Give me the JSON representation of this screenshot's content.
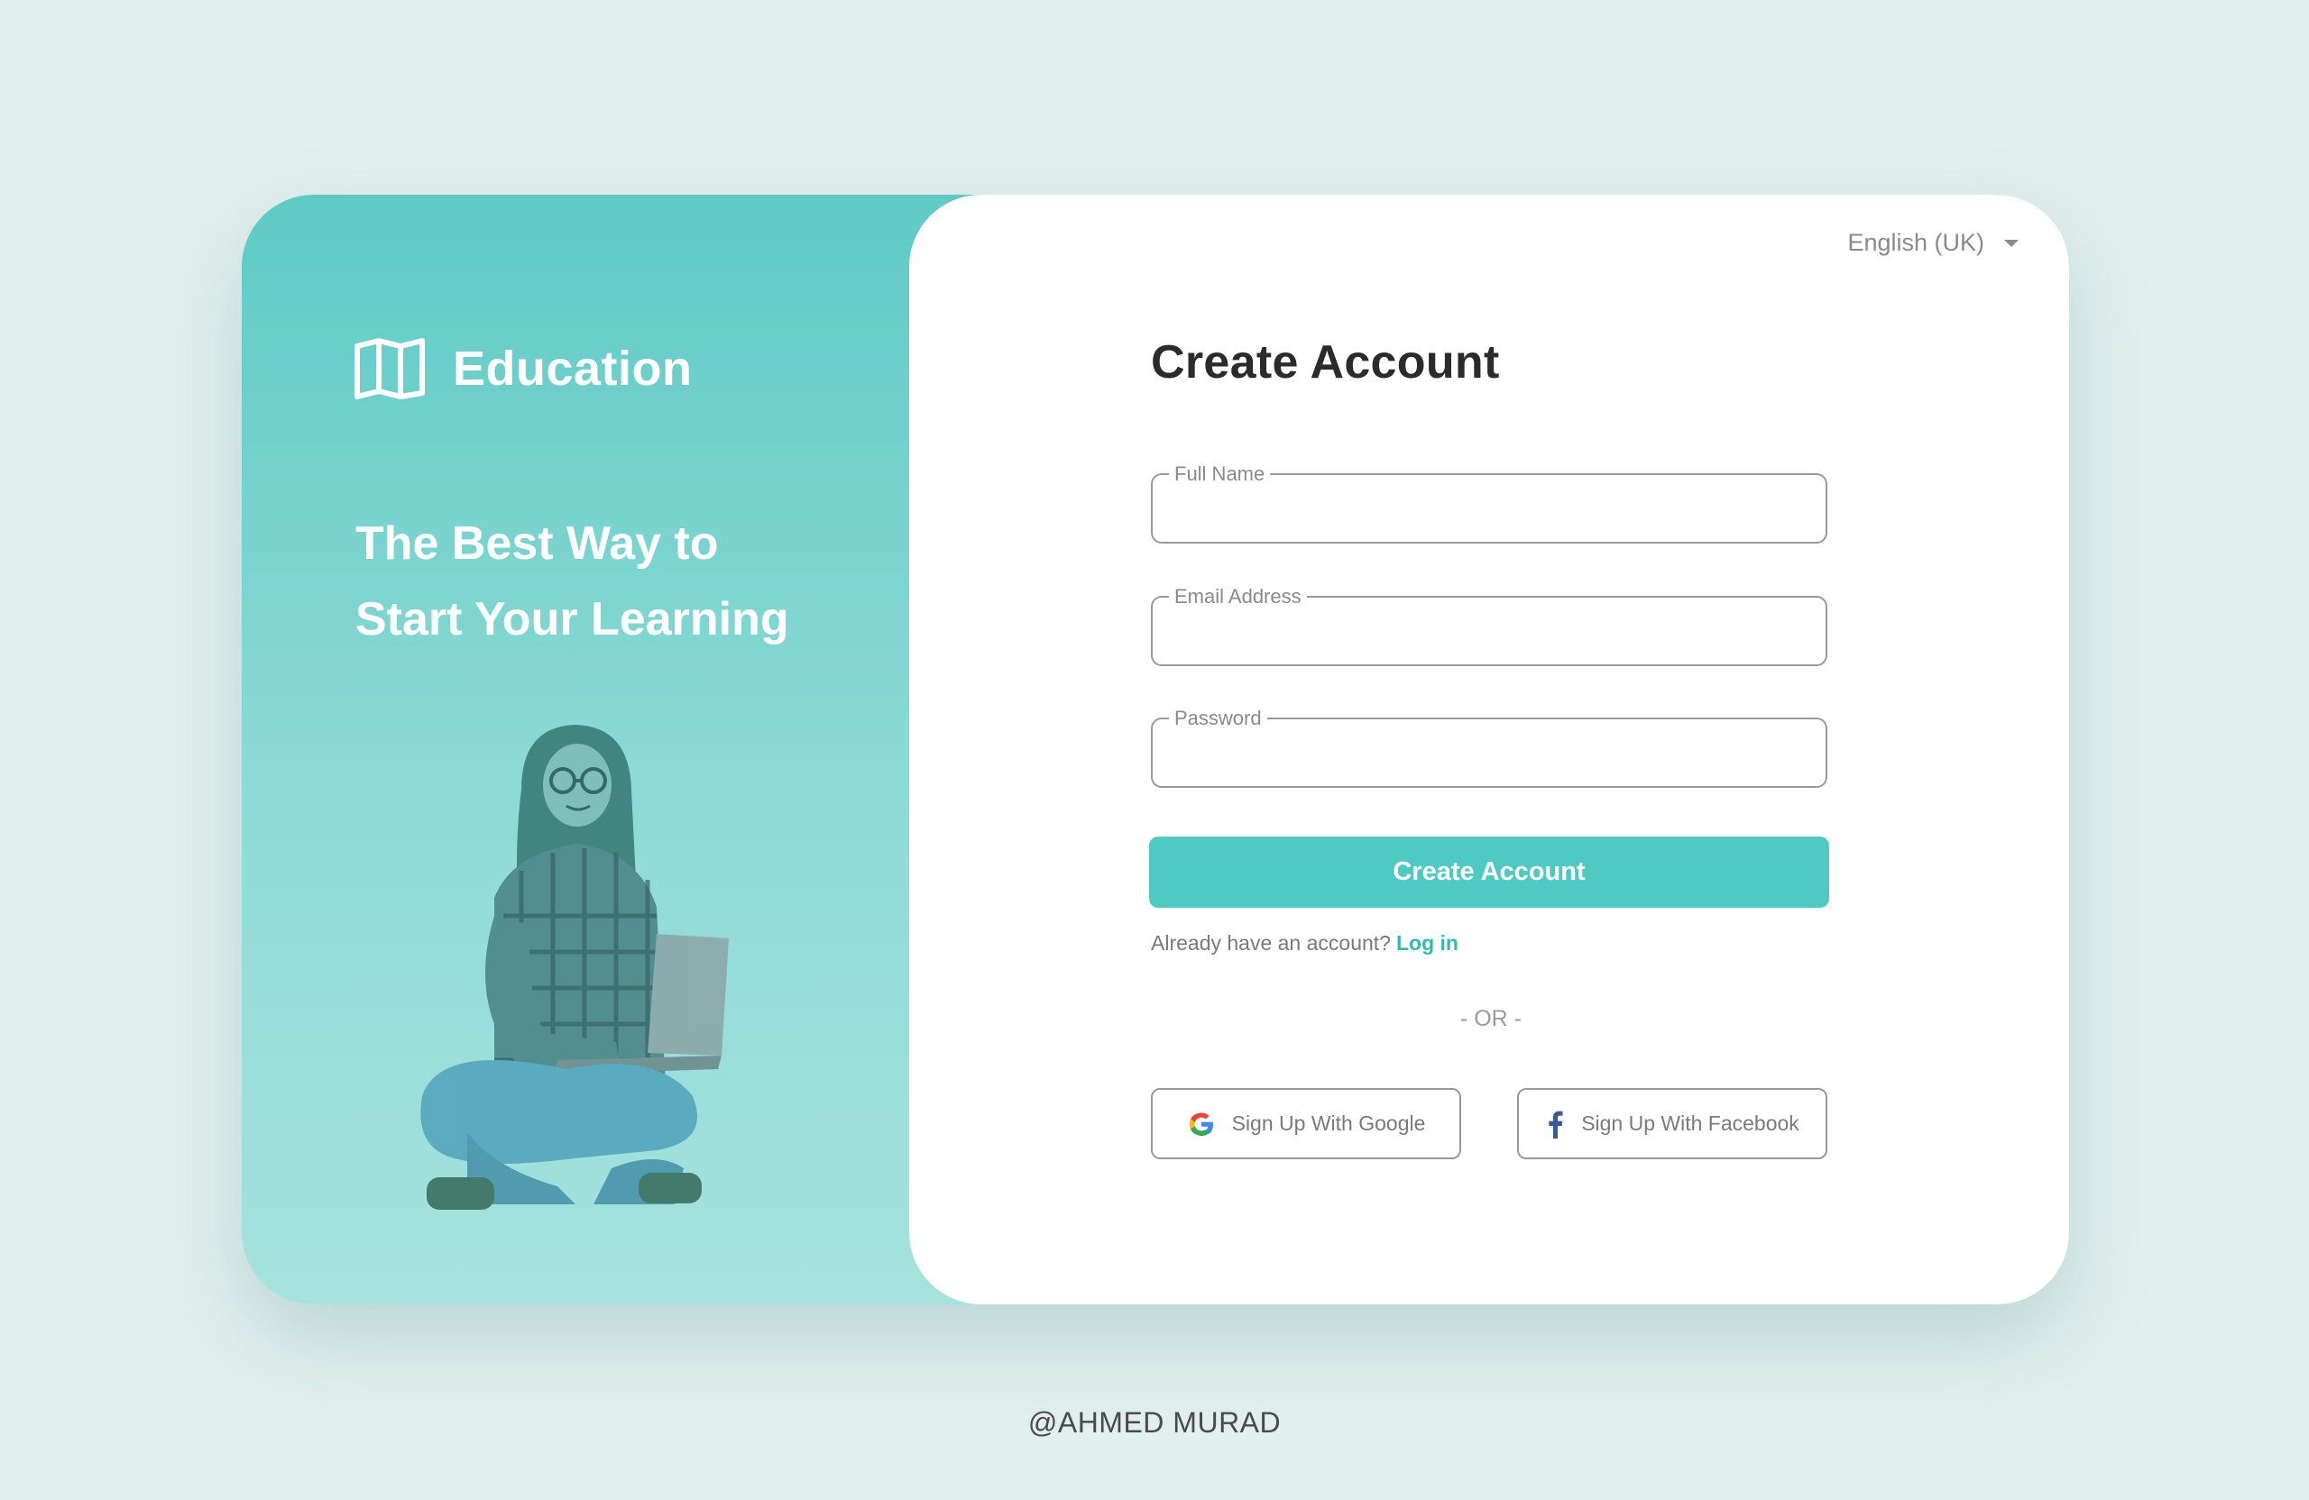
{
  "brand": {
    "name": "Education",
    "icon": "open-book-icon"
  },
  "tagline": {
    "line1": "The Best Way to",
    "line2": "Start Your Learning"
  },
  "language_selector": {
    "value": "English (UK)",
    "icon": "caret-down-icon"
  },
  "form": {
    "title": "Create Account",
    "fields": {
      "full_name_label": "Full Name",
      "email_label": "Email Address",
      "password_label": "Password"
    },
    "submit_label": "Create Account",
    "login_prompt": "Already have an account?",
    "login_link": "Log in",
    "divider": "- OR -",
    "google_label": "Sign Up With Google",
    "facebook_label": "Sign Up With Facebook"
  },
  "credit": "@AHMED MURAD",
  "colors": {
    "accent": "#4fcac3",
    "panel_top": "#5fcac5",
    "panel_bottom": "#a6e2de",
    "background": "#e1efee",
    "link": "#35b8b0"
  }
}
